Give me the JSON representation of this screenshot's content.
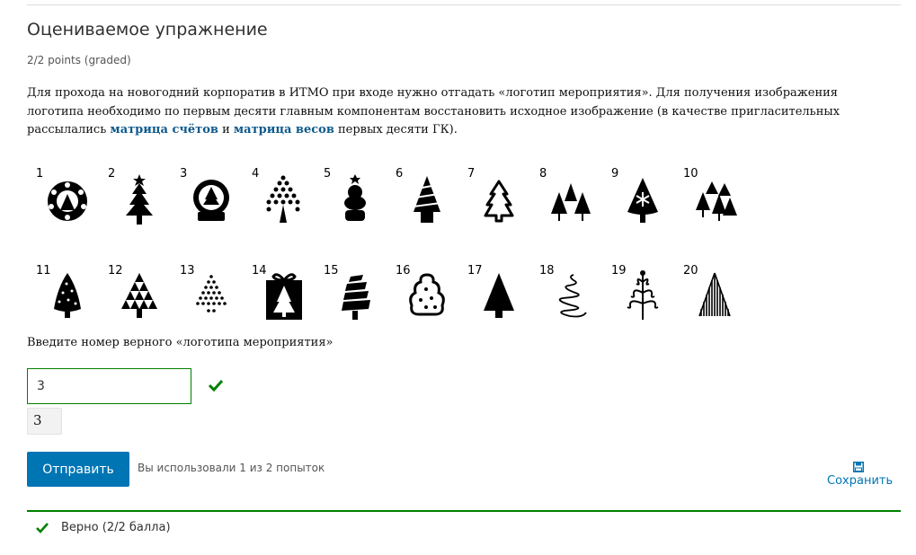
{
  "problem": {
    "title": "Оцениваемое упражнение",
    "points": "2/2 points (graded)",
    "desc_part1": "Для прохода на новогодний корпоратив в ИТМО при входе нужно отгадать «логотип мероприятия». Для получения изображения логотипа необходимо по первым десяти главным компонентам восстановить исходное изображение (в качестве пригласительных рассылались ",
    "desc_link1": "матрица счётов",
    "desc_mid": " и ",
    "desc_link2": "матрица весов",
    "desc_part2": " первых десяти ГК).",
    "prompt": "Введите номер верного «логотипа мероприятия»",
    "input_value": "3",
    "echo_value": "3",
    "submit_label": "Отправить",
    "attempts": "Вы использовали 1 из 2 попыток",
    "save_label": "Сохранить",
    "status": "Верно (2/2 балла)"
  },
  "images": [
    {
      "n": "1",
      "icon": "wreath-tree-icon"
    },
    {
      "n": "2",
      "icon": "star-tree-icon"
    },
    {
      "n": "3",
      "icon": "snow-globe-icon"
    },
    {
      "n": "4",
      "icon": "dotted-tree-icon"
    },
    {
      "n": "5",
      "icon": "round-tree-pot-icon"
    },
    {
      "n": "6",
      "icon": "striped-tree-pot-icon"
    },
    {
      "n": "7",
      "icon": "outline-tree-icon"
    },
    {
      "n": "8",
      "icon": "three-trees-icon"
    },
    {
      "n": "9",
      "icon": "snowflake-tree-icon"
    },
    {
      "n": "10",
      "icon": "forest-icon"
    },
    {
      "n": "11",
      "icon": "dotted-cone-icon"
    },
    {
      "n": "12",
      "icon": "triangle-tree-icon"
    },
    {
      "n": "13",
      "icon": "dot-pyramid-icon"
    },
    {
      "n": "14",
      "icon": "gift-box-icon"
    },
    {
      "n": "15",
      "icon": "ribbon-tree-icon"
    },
    {
      "n": "16",
      "icon": "cloud-tree-icon"
    },
    {
      "n": "17",
      "icon": "solid-tree-icon"
    },
    {
      "n": "18",
      "icon": "spiral-tree-icon"
    },
    {
      "n": "19",
      "icon": "curly-tree-icon"
    },
    {
      "n": "20",
      "icon": "line-tree-icon"
    }
  ]
}
